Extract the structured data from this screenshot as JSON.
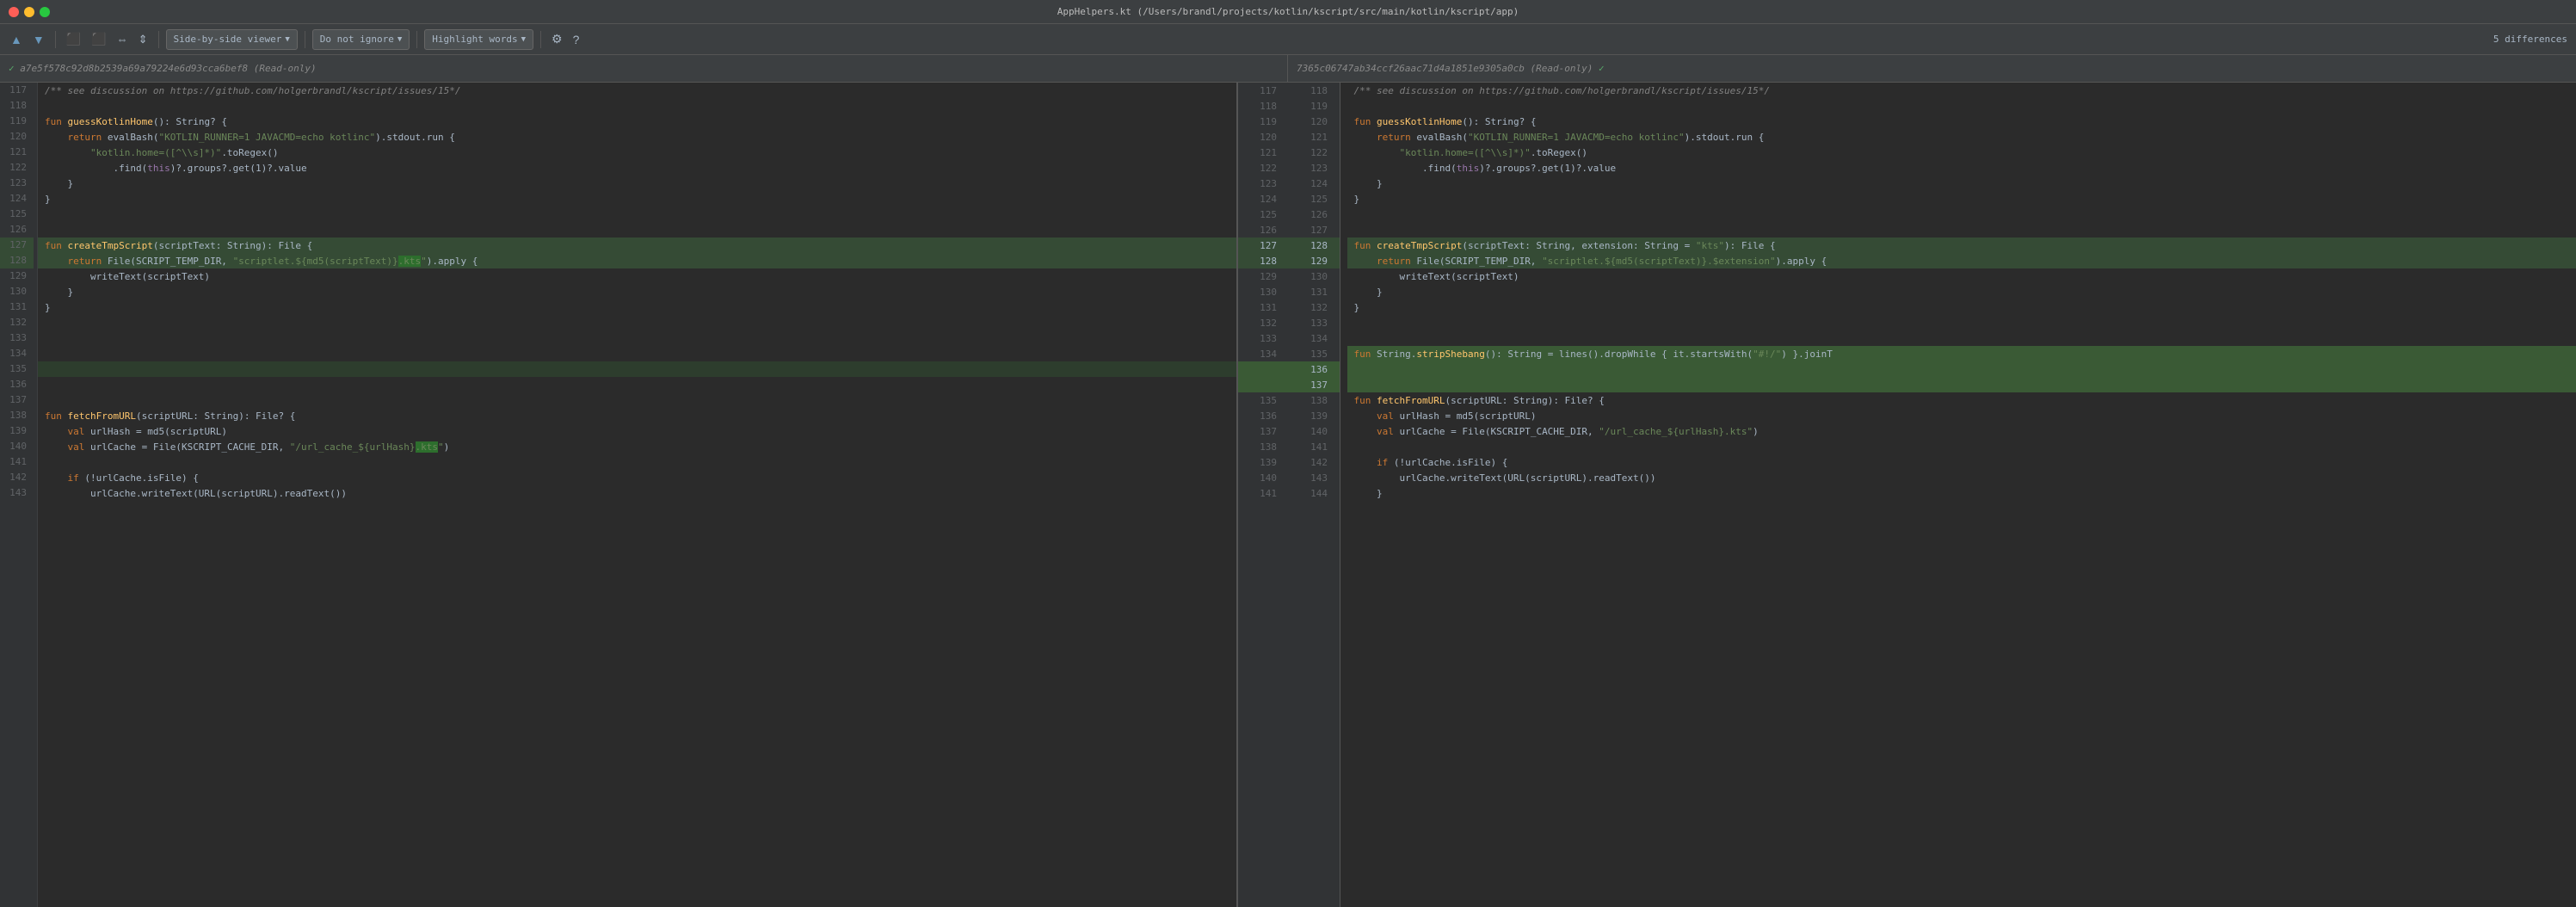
{
  "titlebar": {
    "title": "AppHelpers.kt (/Users/brandl/projects/kotlin/kscript/src/main/kotlin/kscript/app)"
  },
  "toolbar": {
    "nav_prev_label": "▲",
    "nav_next_label": "▼",
    "copy_left_label": "⇐",
    "copy_right_label": "⇒",
    "expand_label": "⇔",
    "collapse_label": "⇕",
    "viewer_label": "Side-by-side viewer",
    "ignore_label": "Do not ignore",
    "highlight_label": "Highlight words",
    "diff_count": "5 differences"
  },
  "left_panel": {
    "hash": "a7e5f578c92d8b2539a69a79224e6d93cca6bef8 (Read-only)"
  },
  "right_panel": {
    "hash": "7365c06747ab34ccf26aac71d4a1851e9305a0cb (Read-only)"
  },
  "lines": {
    "left_nums": [
      117,
      118,
      119,
      120,
      121,
      122,
      123,
      124,
      125,
      126,
      127,
      128,
      129,
      130,
      131,
      132,
      133,
      134,
      135,
      136,
      137,
      138,
      139,
      140,
      141,
      142,
      143
    ],
    "right_nums": [
      118,
      119,
      120,
      121,
      122,
      123,
      124,
      125,
      126,
      127,
      128,
      129,
      130,
      131,
      132,
      133,
      134,
      135,
      136,
      137,
      138,
      139,
      140,
      141,
      142,
      143,
      144
    ]
  }
}
